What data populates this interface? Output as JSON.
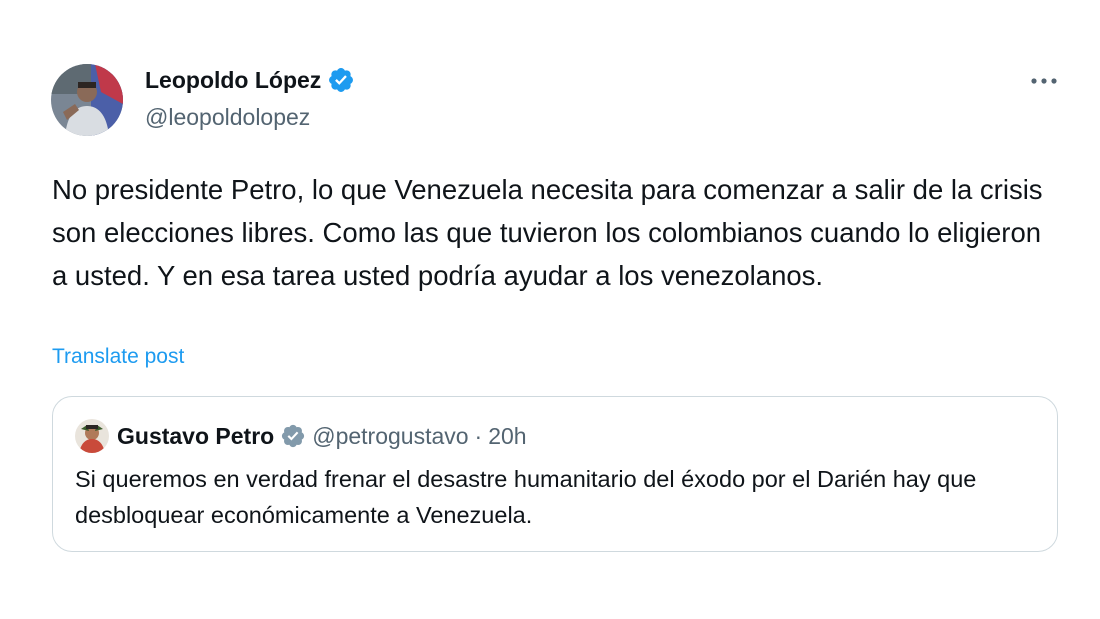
{
  "post": {
    "author": {
      "display_name": "Leopoldo López",
      "handle": "@leopoldolopez",
      "verified_badge_color": "#1d9bf0"
    },
    "text": "No presidente Petro, lo que Venezuela necesita para comenzar a salir de la crisis son elecciones libres. Como las que tuvieron los colombianos cuando lo eligieron a usted. Y en esa tarea usted podría ayudar a los venezolanos.",
    "translate_label": "Translate post",
    "more_icon": "more-dots-icon"
  },
  "quoted_post": {
    "author": {
      "display_name": "Gustavo Petro",
      "handle": "@petrogustavo",
      "verified_badge_color": "#829aab"
    },
    "separator": "·",
    "time": "20h",
    "text": "Si queremos en verdad frenar el desastre humanitario del éxodo por el Darién hay que desbloquear económicamente a Venezuela."
  },
  "colors": {
    "link": "#1d9bf0",
    "secondary_text": "#536471",
    "border": "#cfd9de"
  }
}
